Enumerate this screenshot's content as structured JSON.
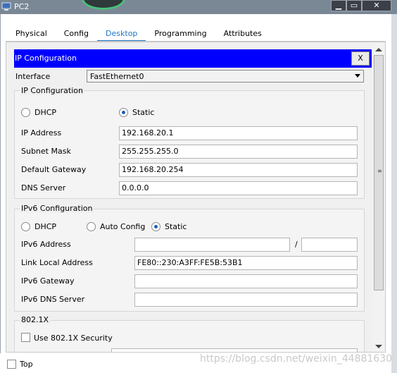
{
  "window": {
    "title": "PC2",
    "minimize_glyph": "▁",
    "maximize_glyph": "▭",
    "close_glyph": "✕"
  },
  "tabs": [
    "Physical",
    "Config",
    "Desktop",
    "Programming",
    "Attributes"
  ],
  "active_tab": "Desktop",
  "ip_config_bar": {
    "title": "IP Configuration",
    "close_label": "X"
  },
  "interface": {
    "label": "Interface",
    "value": "FastEthernet0"
  },
  "ipv4": {
    "group_title": "IP Configuration",
    "dhcp_label": "DHCP",
    "static_label": "Static",
    "selected": "Static",
    "ip_address_label": "IP Address",
    "ip_address": "192.168.20.1",
    "subnet_mask_label": "Subnet Mask",
    "subnet_mask": "255.255.255.0",
    "gateway_label": "Default Gateway",
    "gateway": "192.168.20.254",
    "dns_label": "DNS Server",
    "dns": "0.0.0.0"
  },
  "ipv6": {
    "group_title": "IPv6 Configuration",
    "dhcp_label": "DHCP",
    "auto_label": "Auto Config",
    "static_label": "Static",
    "selected": "Static",
    "address_label": "IPv6 Address",
    "address": "",
    "prefix_separator": "/",
    "prefix": "",
    "link_local_label": "Link Local Address",
    "link_local": "FE80::230:A3FF:FE5B:53B1",
    "gateway_label": "IPv6 Gateway",
    "gateway": "",
    "dns_label": "IPv6 DNS Server",
    "dns": ""
  },
  "dot1x": {
    "group_title": "802.1X",
    "use_security_label": "Use 802.1X Security",
    "checked": false
  },
  "bottom": {
    "top_label": "Top",
    "top_checked": false
  },
  "watermark": "https://blog.csdn.net/weixin_44881630",
  "colors": {
    "ip_bar": "#0000ff",
    "active_tab": "#1e76c4"
  }
}
